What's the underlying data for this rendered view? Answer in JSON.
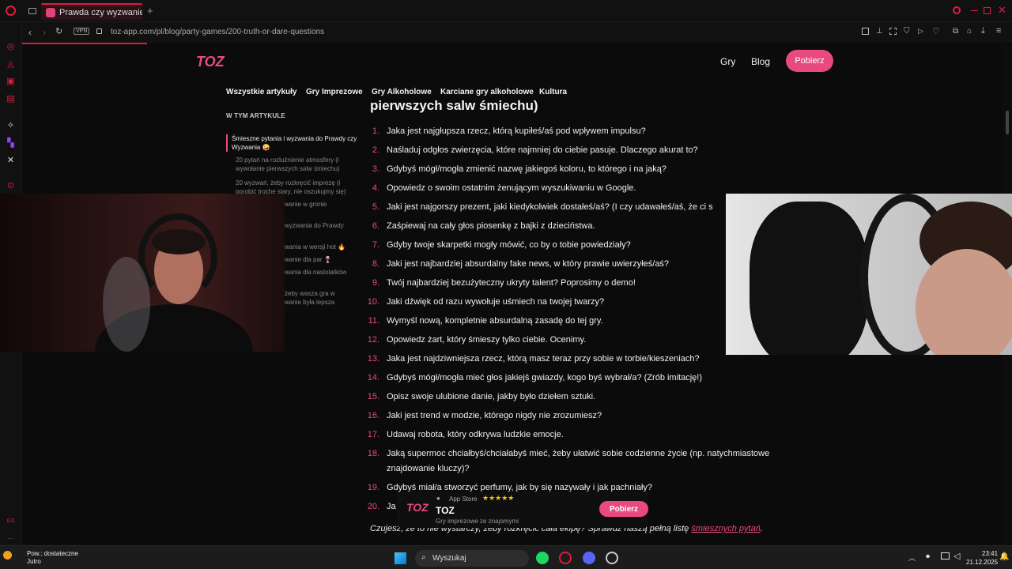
{
  "browser": {
    "tab_title": "Prawda czy wyzwanie: 2‹",
    "url": "toz-app.com/pl/blog/party-games/200-truth-or-dare-questions",
    "vpn_label": "VPN"
  },
  "site": {
    "logo": "TOZ",
    "nav": {
      "games": "Gry",
      "blog": "Blog",
      "cta": "Pobierz"
    },
    "categories": [
      "Wszystkie artykuły",
      "Gry Imprezowe",
      "Gry Alkoholowe",
      "Karciane gry alkoholowe",
      "Kultura"
    ]
  },
  "toc": {
    "title": "W TYM ARTYKULE",
    "active": "Śmieszne pytania i wyzwania do Prawdy czy Wyzwania 🤪",
    "items": [
      "20 pytań na rozluźnienie atmosfery (i wywołanie pierwszych salw śmiechu)",
      "20 wyzwań, żeby rozkręcić imprezę (i porobić trochę siary, nie oszukujmy się)",
      "wanie w gronie",
      "wyzwania do Prawdy",
      "wania w wersji hot 🔥",
      "wanie dla par 🍷",
      "wania dla nastolatków",
      "żeby wasza gra w wanie była lepsza"
    ]
  },
  "article": {
    "heading": "pierwszych salw śmiechu)",
    "questions": [
      "Jaka jest najgłupsza rzecz, którą kupiłeś/aś pod wpływem impulsu?",
      "Naśladuj odgłos zwierzęcia, które najmniej do ciebie pasuje. Dlaczego akurat to?",
      "Gdybyś mógł/mogła zmienić nazwę jakiegoś koloru, to którego i na jaką?",
      "Opowiedz o swoim ostatnim żenującym wyszukiwaniu w Google.",
      "Jaki jest najgorszy prezent, jaki kiedykolwiek dostałeś/aś? (I czy udawałeś/aś, że ci s",
      "Zaśpiewaj na cały głos piosenkę z bajki z dzieciństwa.",
      "Gdyby twoje skarpetki mogły mówić, co by o tobie powiedziały?",
      "Jaki jest najbardziej absurdalny fake news, w który prawie uwierzyłeś/aś?",
      "Twój najbardziej bezużyteczny ukryty talent? Poprosimy o demo!",
      "Jaki dźwięk od razu wywołuje uśmiech na twojej twarzy?",
      "Wymyśl nową, kompletnie absurdalną zasadę do tej gry.",
      "Opowiedz żart, który śmieszy tylko ciebie. Ocenimy.",
      "Jaka jest najdziwniejsza rzecz, którą masz teraz przy sobie w torbie/kieszeniach?",
      "Gdybyś mógł/mogła mieć głos jakiejś gwiazdy, kogo byś wybrał/a? (Zrób imitację!)",
      "Opisz swoje ulubione danie, jakby było dziełem sztuki.",
      "Jaki jest trend w modzie, którego nigdy nie zrozumiesz?",
      "Udawaj robota, który odkrywa ludzkie emocje.",
      "Jaką supermoc chciałbyś/chciałabyś mieć, żeby ułatwić sobie codzienne życie (np. natychmiastowe znajdowanie kluczy)?",
      "Gdybyś miał/a stworzyć perfumy, jak by się nazywały i jak pachniały?",
      "Ja                                                                         sz na telefonie?"
    ],
    "outro_text": "Czujesz, że to nie wystarczy, żeby rozkręcić cała ekipę? Sprawdź naszą pełną listę ",
    "outro_link": "śmiesznych pytań",
    "outro_end": "."
  },
  "app_banner": {
    "store": "App Store",
    "stars": "★★★★★",
    "name": "TOZ",
    "subtitle": "Gry imprezowe ze znajomymi",
    "button": "Pobierz"
  },
  "taskbar": {
    "weather_line1": "Pow.: dostateczne",
    "weather_line2": "Jutro",
    "search": "Wyszukaj",
    "time": "23:41",
    "date": "21.12.2025"
  }
}
